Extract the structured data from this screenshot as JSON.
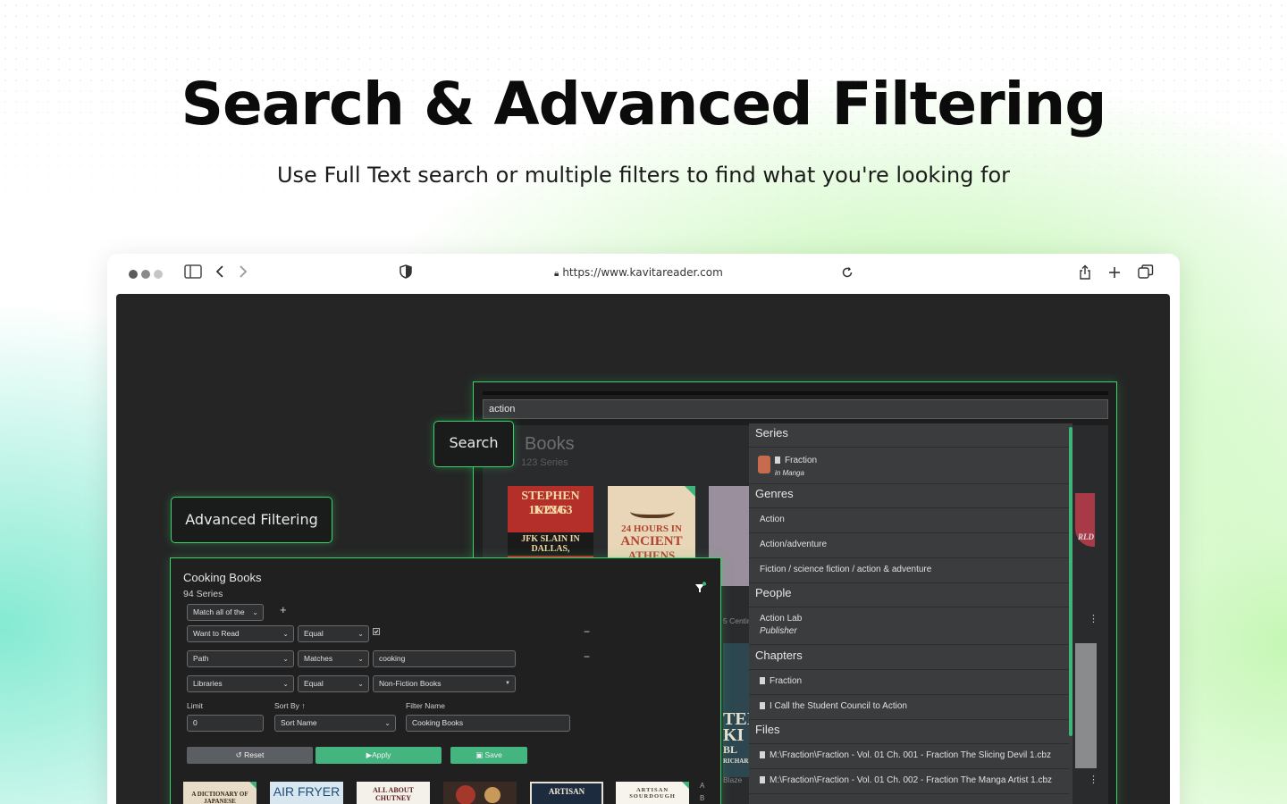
{
  "hero": {
    "title": "Search & Advanced Filtering",
    "subtitle": "Use Full Text search or multiple filters to find what you're looking for"
  },
  "browser": {
    "url": "https://www.kavitareader.com",
    "icons": [
      "sidebar-icon",
      "back-icon",
      "forward-icon",
      "shield-icon",
      "lock-icon",
      "reload-icon",
      "share-icon",
      "new-tab-icon",
      "tabs-icon"
    ]
  },
  "search": {
    "query": "action",
    "callout_label": "Search",
    "library": {
      "title": "Books",
      "count": "123 Series"
    },
    "covers": [
      {
        "line1": "STEPHEN KING",
        "line2": "11/22/63",
        "line3": "JFK SLAIN IN DALLAS,"
      },
      {
        "line1": "24 HOURS IN",
        "line2": "ANCIENT",
        "line3": "ATHENS"
      }
    ],
    "side_labels": {
      "left_a": "5 Centim",
      "left_b": "TEI",
      "left_c": "KI",
      "left_d": "BL",
      "left_e": "RICHARD",
      "left_f": "Blaze",
      "right_a": "RLD"
    },
    "results": {
      "series_header": "Series",
      "series": [
        {
          "name": "Fraction",
          "sub": "in Manga"
        }
      ],
      "genres_header": "Genres",
      "genres": [
        "Action",
        "Action/adventure",
        "Fiction / science fiction / action & adventure"
      ],
      "people_header": "People",
      "people": [
        {
          "name": "Action Lab",
          "role": "Publisher"
        }
      ],
      "chapters_header": "Chapters",
      "chapters": [
        "Fraction",
        "I Call the Student Council to Action"
      ],
      "files_header": "Files",
      "files": [
        "M:\\Fraction\\Fraction - Vol. 01 Ch. 001 - Fraction The Slicing Devil 1.cbz",
        "M:\\Fraction\\Fraction - Vol. 01 Ch. 002 - Fraction The Manga Artist 1.cbz"
      ]
    }
  },
  "filter": {
    "callout_label": "Advanced Filtering",
    "title": "Cooking Books",
    "count": "94 Series",
    "match_mode": "Match all of the",
    "add_label": "+",
    "rows": [
      {
        "field": "Want to Read",
        "op": "Equal",
        "value": ""
      },
      {
        "field": "Path",
        "op": "Matches",
        "value": "cooking"
      },
      {
        "field": "Libraries",
        "op": "Equal",
        "value": "Non-Fiction Books"
      }
    ],
    "remove_label": "−",
    "limit_label": "Limit",
    "limit_value": "0",
    "sort_label": "Sort By",
    "sort_value": "Sort Name",
    "name_label": "Filter Name",
    "name_value": "Cooking Books",
    "reset_label": "Reset",
    "apply_label": "Apply",
    "save_label": "Save",
    "covers": [
      "A DICTIONARY OF JAPANESE",
      "AIR FRYER",
      "ALL ABOUT CHUTNEY",
      "",
      "ARTISAN",
      "ARTISAN SOURDOUGH"
    ],
    "alpha": [
      "A",
      "B"
    ]
  }
}
